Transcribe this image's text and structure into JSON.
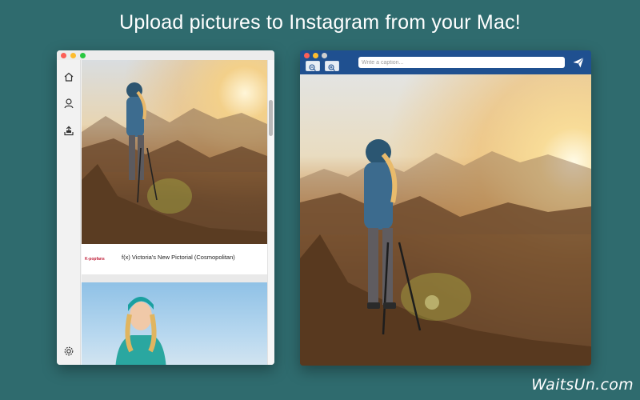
{
  "headline": "Upload pictures to Instagram from your Mac!",
  "left_window": {
    "sidebar_icons": [
      "home-icon",
      "profile-icon",
      "upload-icon",
      "settings-icon"
    ],
    "post": {
      "source_logo": "K-popfans",
      "caption": "f(x) Victoria's New Pictorial (Cosmopolitan)"
    }
  },
  "right_window": {
    "caption_placeholder": "Write a caption...",
    "zoom_out_icon": "zoom-out-icon",
    "zoom_in_icon": "zoom-in-icon",
    "send_icon": "send-icon"
  },
  "watermark": "WaitsUn.com",
  "colors": {
    "background": "#2f6b6e",
    "toolbar": "#1f5090",
    "traffic_red": "#fc5f57",
    "traffic_yellow": "#fdbc2e",
    "traffic_green": "#28c840"
  }
}
